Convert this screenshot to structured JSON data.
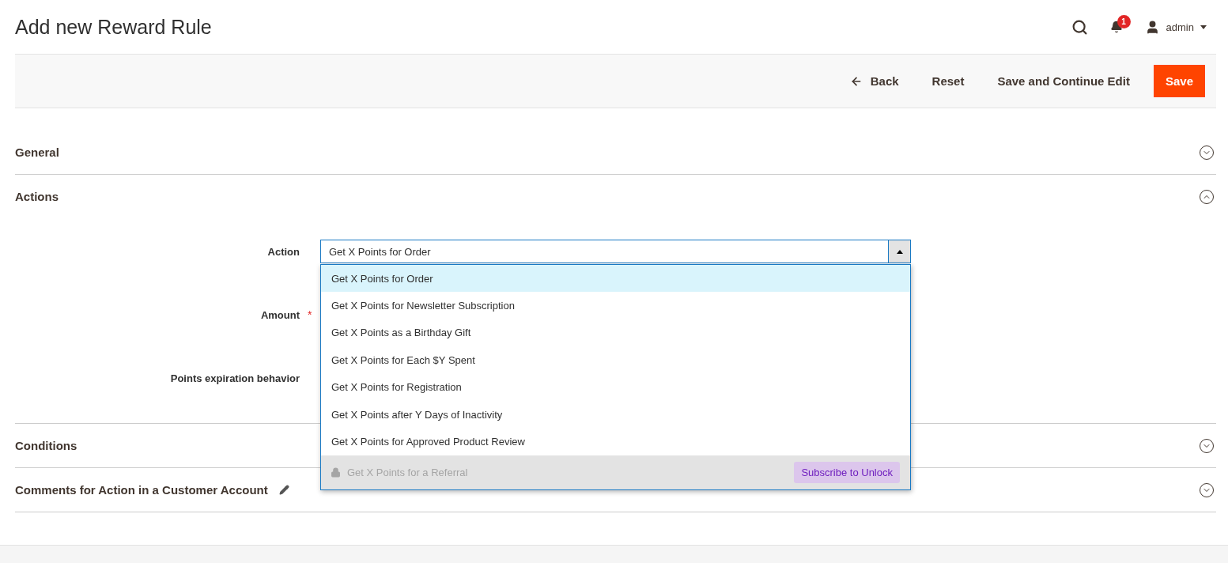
{
  "page_title": "Add new Reward Rule",
  "header": {
    "notification_count": "1",
    "user": "admin"
  },
  "toolbar": {
    "back": "Back",
    "reset": "Reset",
    "save_continue": "Save and Continue Edit",
    "save": "Save"
  },
  "sections": [
    {
      "title": "General",
      "expanded": false,
      "editable": false
    },
    {
      "title": "Actions",
      "expanded": true,
      "editable": false,
      "fields": [
        {
          "label": "Action",
          "kind": "select",
          "value": "Get X Points for Order",
          "open": true,
          "options": [
            {
              "kind": "option",
              "label": "Get X Points for Order",
              "selected": true
            },
            {
              "kind": "option",
              "label": "Get X Points for Newsletter Subscription",
              "selected": false
            },
            {
              "kind": "option",
              "label": "Get X Points as a Birthday Gift",
              "selected": false
            },
            {
              "kind": "option",
              "label": "Get X Points for Each $Y Spent",
              "selected": false
            },
            {
              "kind": "option",
              "label": "Get X Points for Registration",
              "selected": false
            },
            {
              "kind": "option",
              "label": "Get X Points after Y Days of Inactivity",
              "selected": false
            },
            {
              "kind": "option",
              "label": "Get X Points for Approved Product Review",
              "selected": false
            },
            {
              "kind": "locked",
              "label": "Get X Points for a Referral",
              "selected": false,
              "badge": "Subscribe to Unlock"
            }
          ]
        },
        {
          "label": "Amount",
          "required_mark": "*",
          "kind": "hidden"
        },
        {
          "label": "Points expiration behavior",
          "kind": "hidden"
        }
      ]
    },
    {
      "title": "Conditions",
      "expanded": false,
      "editable": false
    },
    {
      "title": "Comments for Action in a Customer Account",
      "expanded": false,
      "editable": true
    }
  ]
}
